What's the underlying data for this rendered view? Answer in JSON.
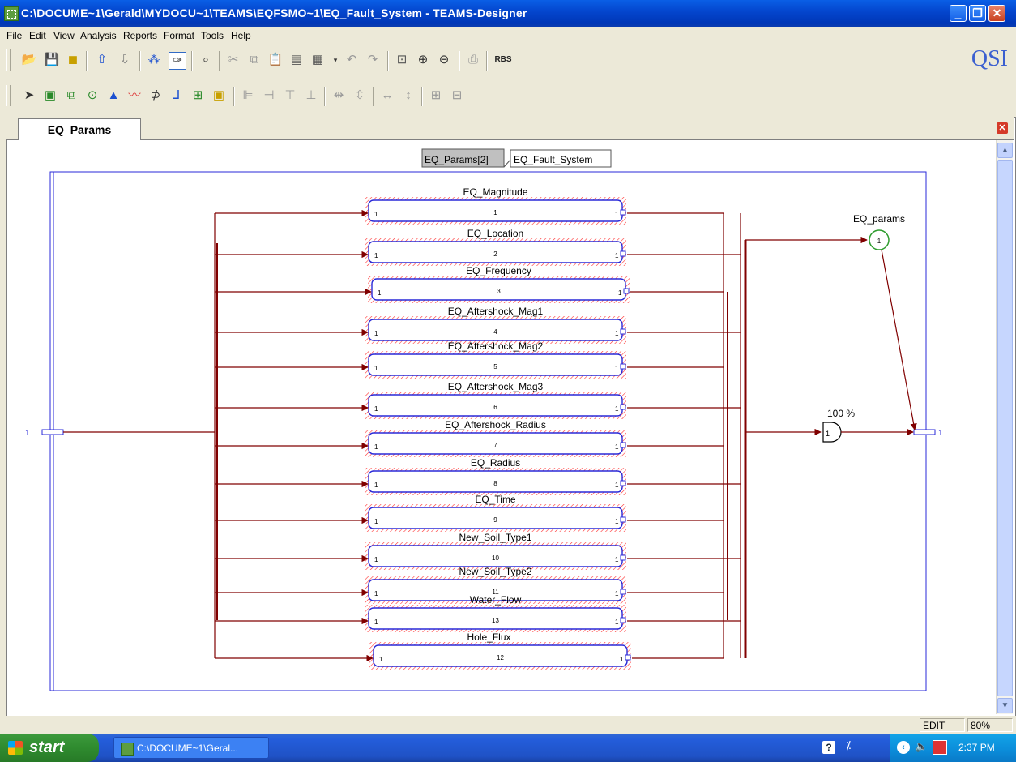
{
  "window": {
    "title": "C:\\DOCUME~1\\Gerald\\MYDOCU~1\\TEAMS\\EQFSMO~1\\EQ_Fault_System - TEAMS-Designer"
  },
  "menu": [
    "File",
    "Edit",
    "View",
    "Analysis",
    "Reports",
    "Format",
    "Tools",
    "Help"
  ],
  "toolbar": {
    "rbs_label": "RBS",
    "brand": "QSI"
  },
  "tab": {
    "label": "EQ_Params"
  },
  "diagram": {
    "breadcrumb": {
      "current": "EQ_Params[2]",
      "parent": "EQ_Fault_System"
    },
    "input_port_label": "1",
    "output_port_label": "1",
    "and_gate_label": "100 %",
    "and_gate_port": "1",
    "test_point_label": "EQ_params",
    "test_point_number": "1",
    "modules": [
      {
        "name": "EQ_Magnitude",
        "number": "1",
        "in": "1",
        "out": "1"
      },
      {
        "name": "EQ_Location",
        "number": "2",
        "in": "1",
        "out": "1"
      },
      {
        "name": "EQ_Frequency",
        "number": "3",
        "in": "1",
        "out": "1"
      },
      {
        "name": "EQ_Aftershock_Mag1",
        "number": "4",
        "in": "1",
        "out": "1"
      },
      {
        "name": "EQ_Aftershock_Mag2",
        "number": "5",
        "in": "1",
        "out": "1"
      },
      {
        "name": "EQ_Aftershock_Mag3",
        "number": "6",
        "in": "1",
        "out": "1"
      },
      {
        "name": "EQ_Aftershock_Radius",
        "number": "7",
        "in": "1",
        "out": "1"
      },
      {
        "name": "EQ_Radius",
        "number": "8",
        "in": "1",
        "out": "1"
      },
      {
        "name": "EQ_Time",
        "number": "9",
        "in": "1",
        "out": "1"
      },
      {
        "name": "New_Soil_Type1",
        "number": "10",
        "in": "1",
        "out": "1"
      },
      {
        "name": "New_Soil_Type2",
        "number": "11",
        "in": "1",
        "out": "1"
      },
      {
        "name": "Water_Flow",
        "number": "13",
        "in": "1",
        "out": "1"
      },
      {
        "name": "Hole_Flux",
        "number": "12",
        "in": "1",
        "out": "1"
      }
    ]
  },
  "status": {
    "mode": "EDIT",
    "zoom": "80%"
  },
  "taskbar": {
    "start_label": "start",
    "task_label": "C:\\DOCUME~1\\Geral...",
    "clock": "2:37 PM"
  },
  "colors": {
    "wire": "#800000",
    "module_border": "#2a2ad8",
    "hatch": "#ff3030",
    "frame": "#2a2ad8",
    "test_point": "#2e9c2e"
  }
}
